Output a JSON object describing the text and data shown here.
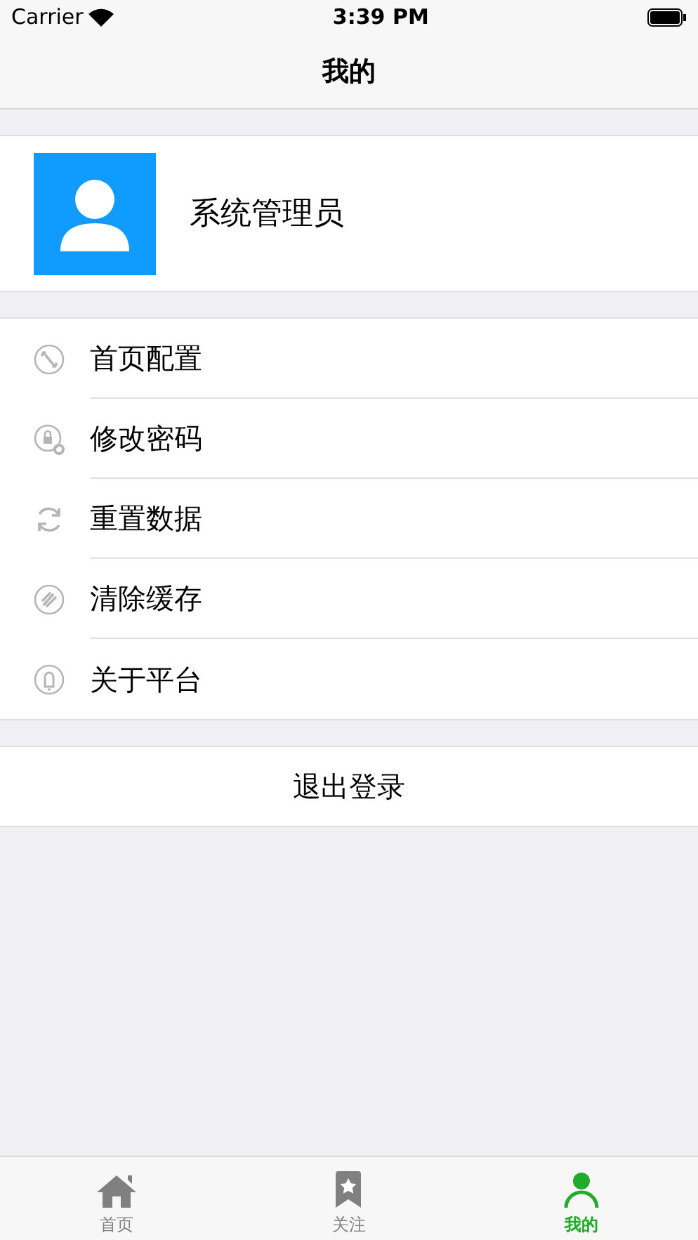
{
  "status_bar": {
    "carrier": "Carrier",
    "time": "3:39 PM"
  },
  "nav": {
    "title": "我的"
  },
  "profile": {
    "name": "系统管理员"
  },
  "menu": [
    {
      "kind": "wrench",
      "label": "首页配置"
    },
    {
      "kind": "lock",
      "label": "修改密码"
    },
    {
      "kind": "refresh",
      "label": "重置数据"
    },
    {
      "kind": "broom",
      "label": "清除缓存"
    },
    {
      "kind": "info",
      "label": "关于平台"
    }
  ],
  "logout": {
    "label": "退出登录"
  },
  "tab_bar": [
    {
      "kind": "home",
      "label": "首页",
      "selected": false
    },
    {
      "kind": "star",
      "label": "关注",
      "selected": false
    },
    {
      "kind": "person",
      "label": "我的",
      "selected": true
    }
  ]
}
